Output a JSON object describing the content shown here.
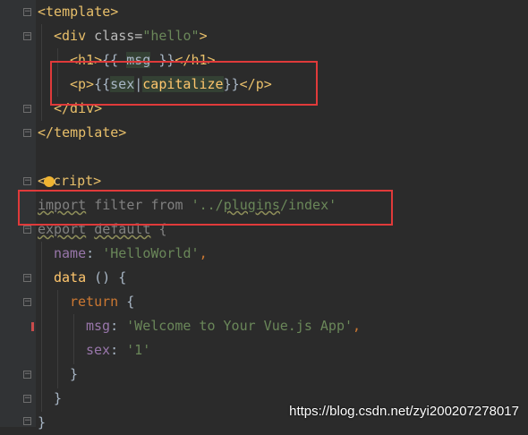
{
  "editor": {
    "lines": {
      "l1": {
        "tag_open": "<template>"
      },
      "l2": {
        "open": "<div ",
        "attr": "class=",
        "value": "\"hello\"",
        "close": ">"
      },
      "l3": {
        "open": "<h1>",
        "expr_open": "{{ ",
        "var": "msg",
        "expr_close": " }}",
        "close": "</h1>"
      },
      "l4": {
        "open": "<p>",
        "expr_open": "{{",
        "var": "sex",
        "pipe": "|",
        "filter": "capitalize",
        "expr_close": "}}",
        "close": "</p>"
      },
      "l5": {
        "text": "</div>"
      },
      "l6": {
        "text": "</template>"
      },
      "l8": {
        "pre": "<",
        "post": "cript>"
      },
      "l9": {
        "kw1": "import",
        "name": " filter ",
        "kw2": "from",
        "sp": " ",
        "q1": "'",
        "path1": "../",
        "path2": "plugins",
        "path3": "/index",
        "q2": "'"
      },
      "l10": {
        "kw1": "export",
        "sp": " ",
        "kw2": "default",
        "rest": " {"
      },
      "l11": {
        "prop": "name",
        "colon": ": ",
        "val": "'HelloWorld'",
        "comma": ","
      },
      "l12": {
        "fn": "data",
        "rest": " () {"
      },
      "l13": {
        "kw": "return",
        "rest": " {"
      },
      "l14": {
        "prop": "msg",
        "colon": ": ",
        "val": "'Welcome to Your Vue.js App'",
        "comma": ","
      },
      "l15": {
        "prop": "sex",
        "colon": ": ",
        "val": "'1'"
      },
      "l16": {
        "text": "}"
      },
      "l17": {
        "text": "}"
      },
      "l18": {
        "text": "}"
      }
    },
    "marker_color": "#c94b4b",
    "highlight_box_color": "#e03a3a"
  },
  "watermark": "https://blog.csdn.net/zyi200207278017"
}
